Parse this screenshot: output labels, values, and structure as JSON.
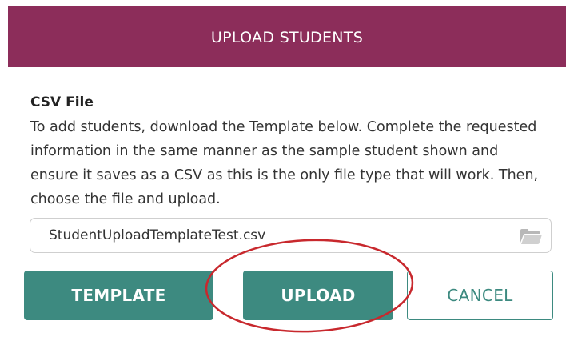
{
  "modal": {
    "title": "UPLOAD STUDENTS",
    "header_color": "#8c2d5a"
  },
  "form": {
    "field_label": "CSV File",
    "help_text": "To add students, download the Template below. Complete the requested information in the same manner as the sample student shown and ensure it saves as a CSV as this is the only file type that will work. Then, choose the file and upload.",
    "file_value": "StudentUploadTemplateTest.csv",
    "browse_icon": "folder-icon"
  },
  "buttons": {
    "template_label": "TEMPLATE",
    "upload_label": "UPLOAD",
    "cancel_label": "CANCEL",
    "accent_color": "#3d8a80"
  },
  "annotation": {
    "type": "red-ellipse",
    "color": "#c8282d",
    "target": "upload-button"
  }
}
